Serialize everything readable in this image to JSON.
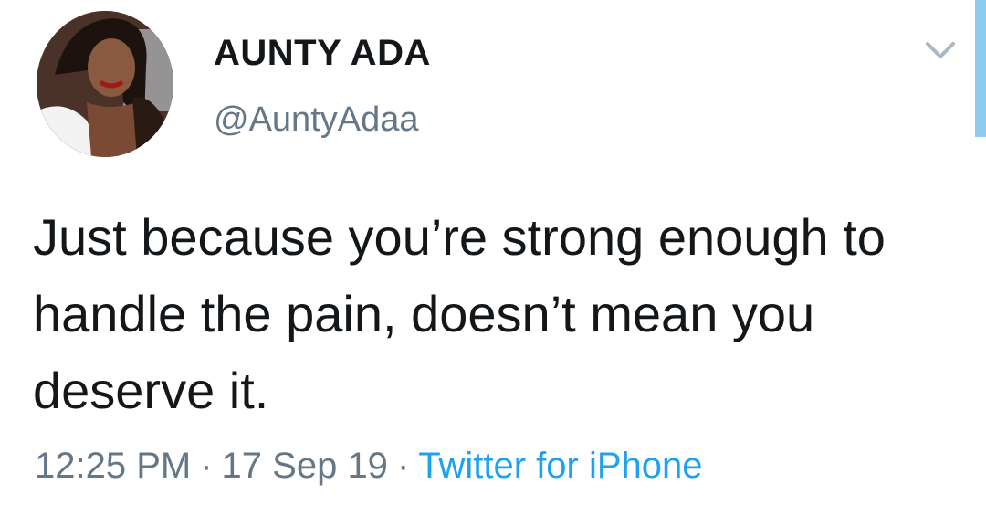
{
  "author": {
    "display_name": "AUNTY ADA",
    "handle": "@AuntyAdaa",
    "avatar": "profile-photo"
  },
  "tweet": {
    "text": "Just because you’re strong enough to handle the pain, doesn’t mean you deserve it."
  },
  "meta": {
    "time": "12:25 PM",
    "separator": "·",
    "date": "17 Sep 19",
    "source": "Twitter for iPhone"
  },
  "icons": {
    "menu": "chevron-down-icon"
  },
  "colors": {
    "name": "#14171a",
    "secondary": "#657786",
    "link": "#1da1f2",
    "accent_bar": "#8ecbef"
  }
}
